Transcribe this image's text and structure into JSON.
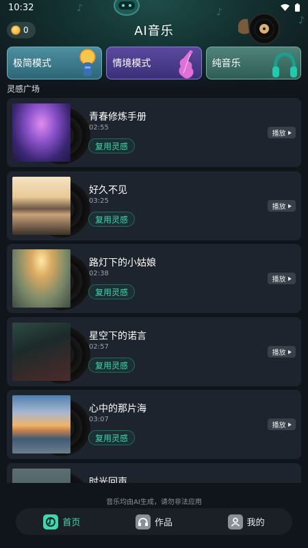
{
  "status_bar": {
    "time": "10:32"
  },
  "header": {
    "coin_count": "0",
    "title": "AI音乐"
  },
  "modes": [
    {
      "label": "极简模式",
      "icon": "microphone-icon"
    },
    {
      "label": "情境模式",
      "icon": "violin-icon"
    },
    {
      "label": "纯音乐",
      "icon": "headphones-icon"
    }
  ],
  "section_title": "灵感广场",
  "songs": [
    {
      "title": "青春修炼手册",
      "duration": "02:55",
      "reuse_label": "复用灵感",
      "play_label": "播放"
    },
    {
      "title": "好久不见",
      "duration": "03:25",
      "reuse_label": "复用灵感",
      "play_label": "播放"
    },
    {
      "title": "路灯下的小姑娘",
      "duration": "02:38",
      "reuse_label": "复用灵感",
      "play_label": "播放"
    },
    {
      "title": "星空下的诺言",
      "duration": "02:57",
      "reuse_label": "复用灵感",
      "play_label": "播放"
    },
    {
      "title": "心中的那片海",
      "duration": "03:07",
      "reuse_label": "复用灵感",
      "play_label": "播放"
    },
    {
      "title": "时光回声",
      "duration": "",
      "reuse_label": "",
      "play_label": ""
    }
  ],
  "disclaimer": "音乐均由AI生成，请勿非法应用",
  "tabs": [
    {
      "label": "首页",
      "icon": "music-note-icon",
      "active": true
    },
    {
      "label": "作品",
      "icon": "headphones-icon",
      "active": false
    },
    {
      "label": "我的",
      "icon": "user-icon",
      "active": false
    }
  ],
  "colors": {
    "accent": "#3ed7b0",
    "background": "#10151c",
    "card": "#1e242d"
  }
}
